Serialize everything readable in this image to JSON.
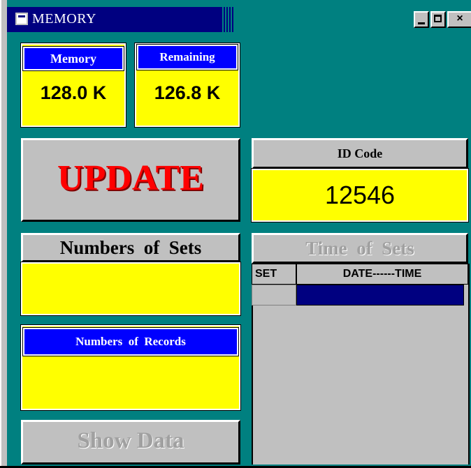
{
  "window": {
    "title": "MEMORY",
    "controls": {
      "minimize": "_",
      "maximize": "□",
      "close": "×"
    }
  },
  "memory": {
    "label": "Memory",
    "value": "128.0 K"
  },
  "remaining": {
    "label": "Remaining",
    "value": "126.8 K"
  },
  "update_button": {
    "label": "UPDATE"
  },
  "id_code": {
    "label": "ID Code",
    "value": "12546"
  },
  "sets": {
    "label": "Numbers  of  Sets",
    "value": ""
  },
  "records": {
    "label": "Numbers  of  Records",
    "value": ""
  },
  "show_data_button": {
    "label": "Show Data",
    "enabled": false
  },
  "time_of_sets": {
    "label": "Time  of  Sets",
    "enabled": false,
    "columns": [
      "SET",
      "DATE------TIME"
    ],
    "rows": [
      {
        "set": "",
        "datetime": ""
      }
    ]
  },
  "colors": {
    "background": "#008080",
    "panel_yellow": "#ffff00",
    "header_blue": "#0000ff",
    "update_red": "#ff0000",
    "selection_navy": "#000080"
  }
}
